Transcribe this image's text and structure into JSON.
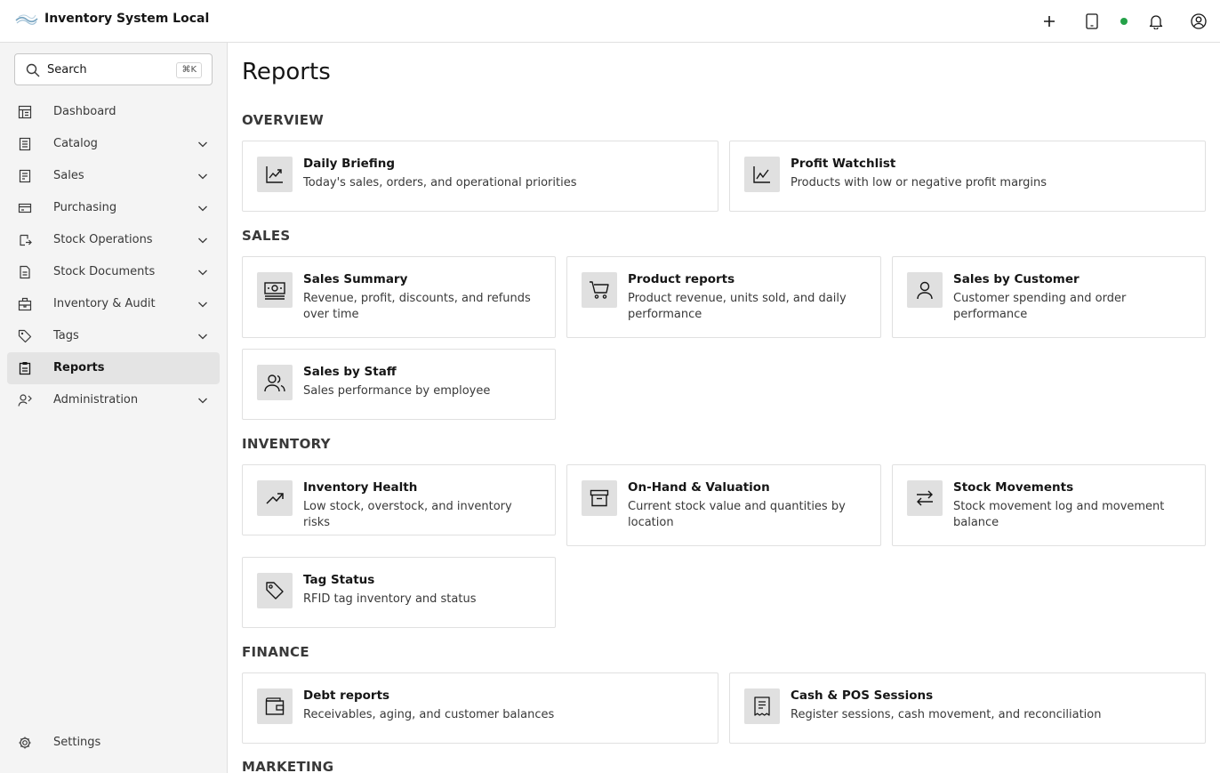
{
  "header": {
    "app_title": "Inventory System Local",
    "status_color": "#24a148",
    "icons": [
      "plus-icon",
      "tablet-icon",
      "status-dot",
      "bell-icon",
      "user-icon"
    ]
  },
  "sidebar": {
    "search": {
      "label": "Search",
      "shortcut": "⌘K"
    },
    "items": [
      {
        "label": "Dashboard",
        "icon": "dashboard-icon",
        "expandable": false,
        "active": false
      },
      {
        "label": "Catalog",
        "icon": "catalog-icon",
        "expandable": true,
        "active": false
      },
      {
        "label": "Sales",
        "icon": "sales-icon",
        "expandable": true,
        "active": false
      },
      {
        "label": "Purchasing",
        "icon": "purchasing-icon",
        "expandable": true,
        "active": false
      },
      {
        "label": "Stock Operations",
        "icon": "stock-operations-icon",
        "expandable": true,
        "active": false
      },
      {
        "label": "Stock Documents",
        "icon": "stock-documents-icon",
        "expandable": true,
        "active": false
      },
      {
        "label": "Inventory & Audit",
        "icon": "inventory-audit-icon",
        "expandable": true,
        "active": false
      },
      {
        "label": "Tags",
        "icon": "tag-icon",
        "expandable": true,
        "active": false
      },
      {
        "label": "Reports",
        "icon": "reports-icon",
        "expandable": false,
        "active": true
      },
      {
        "label": "Administration",
        "icon": "administration-icon",
        "expandable": true,
        "active": false
      }
    ],
    "settings_label": "Settings"
  },
  "main": {
    "title": "Reports",
    "sections": [
      {
        "title": "OVERVIEW",
        "cards": [
          {
            "title": "Daily Briefing",
            "desc": "Today's sales, orders, and operational priorities",
            "icon": "chart-trend-icon"
          },
          {
            "title": "Profit Watchlist",
            "desc": "Products with low or negative profit margins",
            "icon": "line-chart-icon"
          }
        ]
      },
      {
        "title": "SALES",
        "cards": [
          {
            "title": "Sales Summary",
            "desc": "Revenue, profit, discounts, and refunds over time",
            "icon": "money-icon"
          },
          {
            "title": "Product reports",
            "desc": "Product revenue, units sold, and daily performance",
            "icon": "cart-icon"
          },
          {
            "title": "Sales by Customer",
            "desc": "Customer spending and order performance",
            "icon": "person-icon"
          },
          {
            "title": "Sales by Staff",
            "desc": "Sales performance by employee",
            "icon": "group-icon"
          }
        ]
      },
      {
        "title": "INVENTORY",
        "cards": [
          {
            "title": "Inventory Health",
            "desc": "Low stock, overstock, and inventory risks",
            "icon": "arrow-up-right-icon"
          },
          {
            "title": "On-Hand & Valuation",
            "desc": "Current stock value and quantities by location",
            "icon": "archive-icon"
          },
          {
            "title": "Stock Movements",
            "desc": "Stock movement log and movement balance",
            "icon": "arrows-swap-icon"
          },
          {
            "title": "Tag Status",
            "desc": "RFID tag inventory and status",
            "icon": "tag-icon"
          }
        ]
      },
      {
        "title": "FINANCE",
        "cards": [
          {
            "title": "Debt reports",
            "desc": "Receivables, aging, and customer balances",
            "icon": "wallet-icon"
          },
          {
            "title": "Cash & POS Sessions",
            "desc": "Register sessions, cash movement, and reconciliation",
            "icon": "receipt-icon"
          }
        ]
      },
      {
        "title": "MARKETING",
        "cards": []
      }
    ]
  }
}
